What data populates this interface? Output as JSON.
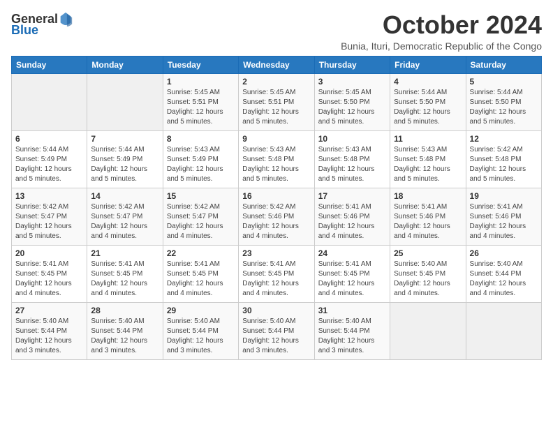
{
  "logo": {
    "general": "General",
    "blue": "Blue"
  },
  "title": "October 2024",
  "location": "Bunia, Ituri, Democratic Republic of the Congo",
  "weekdays": [
    "Sunday",
    "Monday",
    "Tuesday",
    "Wednesday",
    "Thursday",
    "Friday",
    "Saturday"
  ],
  "weeks": [
    [
      {
        "day": "",
        "sunrise": "",
        "sunset": "",
        "daylight": ""
      },
      {
        "day": "",
        "sunrise": "",
        "sunset": "",
        "daylight": ""
      },
      {
        "day": "1",
        "sunrise": "Sunrise: 5:45 AM",
        "sunset": "Sunset: 5:51 PM",
        "daylight": "Daylight: 12 hours and 5 minutes."
      },
      {
        "day": "2",
        "sunrise": "Sunrise: 5:45 AM",
        "sunset": "Sunset: 5:51 PM",
        "daylight": "Daylight: 12 hours and 5 minutes."
      },
      {
        "day": "3",
        "sunrise": "Sunrise: 5:45 AM",
        "sunset": "Sunset: 5:50 PM",
        "daylight": "Daylight: 12 hours and 5 minutes."
      },
      {
        "day": "4",
        "sunrise": "Sunrise: 5:44 AM",
        "sunset": "Sunset: 5:50 PM",
        "daylight": "Daylight: 12 hours and 5 minutes."
      },
      {
        "day": "5",
        "sunrise": "Sunrise: 5:44 AM",
        "sunset": "Sunset: 5:50 PM",
        "daylight": "Daylight: 12 hours and 5 minutes."
      }
    ],
    [
      {
        "day": "6",
        "sunrise": "Sunrise: 5:44 AM",
        "sunset": "Sunset: 5:49 PM",
        "daylight": "Daylight: 12 hours and 5 minutes."
      },
      {
        "day": "7",
        "sunrise": "Sunrise: 5:44 AM",
        "sunset": "Sunset: 5:49 PM",
        "daylight": "Daylight: 12 hours and 5 minutes."
      },
      {
        "day": "8",
        "sunrise": "Sunrise: 5:43 AM",
        "sunset": "Sunset: 5:49 PM",
        "daylight": "Daylight: 12 hours and 5 minutes."
      },
      {
        "day": "9",
        "sunrise": "Sunrise: 5:43 AM",
        "sunset": "Sunset: 5:48 PM",
        "daylight": "Daylight: 12 hours and 5 minutes."
      },
      {
        "day": "10",
        "sunrise": "Sunrise: 5:43 AM",
        "sunset": "Sunset: 5:48 PM",
        "daylight": "Daylight: 12 hours and 5 minutes."
      },
      {
        "day": "11",
        "sunrise": "Sunrise: 5:43 AM",
        "sunset": "Sunset: 5:48 PM",
        "daylight": "Daylight: 12 hours and 5 minutes."
      },
      {
        "day": "12",
        "sunrise": "Sunrise: 5:42 AM",
        "sunset": "Sunset: 5:48 PM",
        "daylight": "Daylight: 12 hours and 5 minutes."
      }
    ],
    [
      {
        "day": "13",
        "sunrise": "Sunrise: 5:42 AM",
        "sunset": "Sunset: 5:47 PM",
        "daylight": "Daylight: 12 hours and 5 minutes."
      },
      {
        "day": "14",
        "sunrise": "Sunrise: 5:42 AM",
        "sunset": "Sunset: 5:47 PM",
        "daylight": "Daylight: 12 hours and 4 minutes."
      },
      {
        "day": "15",
        "sunrise": "Sunrise: 5:42 AM",
        "sunset": "Sunset: 5:47 PM",
        "daylight": "Daylight: 12 hours and 4 minutes."
      },
      {
        "day": "16",
        "sunrise": "Sunrise: 5:42 AM",
        "sunset": "Sunset: 5:46 PM",
        "daylight": "Daylight: 12 hours and 4 minutes."
      },
      {
        "day": "17",
        "sunrise": "Sunrise: 5:41 AM",
        "sunset": "Sunset: 5:46 PM",
        "daylight": "Daylight: 12 hours and 4 minutes."
      },
      {
        "day": "18",
        "sunrise": "Sunrise: 5:41 AM",
        "sunset": "Sunset: 5:46 PM",
        "daylight": "Daylight: 12 hours and 4 minutes."
      },
      {
        "day": "19",
        "sunrise": "Sunrise: 5:41 AM",
        "sunset": "Sunset: 5:46 PM",
        "daylight": "Daylight: 12 hours and 4 minutes."
      }
    ],
    [
      {
        "day": "20",
        "sunrise": "Sunrise: 5:41 AM",
        "sunset": "Sunset: 5:45 PM",
        "daylight": "Daylight: 12 hours and 4 minutes."
      },
      {
        "day": "21",
        "sunrise": "Sunrise: 5:41 AM",
        "sunset": "Sunset: 5:45 PM",
        "daylight": "Daylight: 12 hours and 4 minutes."
      },
      {
        "day": "22",
        "sunrise": "Sunrise: 5:41 AM",
        "sunset": "Sunset: 5:45 PM",
        "daylight": "Daylight: 12 hours and 4 minutes."
      },
      {
        "day": "23",
        "sunrise": "Sunrise: 5:41 AM",
        "sunset": "Sunset: 5:45 PM",
        "daylight": "Daylight: 12 hours and 4 minutes."
      },
      {
        "day": "24",
        "sunrise": "Sunrise: 5:41 AM",
        "sunset": "Sunset: 5:45 PM",
        "daylight": "Daylight: 12 hours and 4 minutes."
      },
      {
        "day": "25",
        "sunrise": "Sunrise: 5:40 AM",
        "sunset": "Sunset: 5:45 PM",
        "daylight": "Daylight: 12 hours and 4 minutes."
      },
      {
        "day": "26",
        "sunrise": "Sunrise: 5:40 AM",
        "sunset": "Sunset: 5:44 PM",
        "daylight": "Daylight: 12 hours and 4 minutes."
      }
    ],
    [
      {
        "day": "27",
        "sunrise": "Sunrise: 5:40 AM",
        "sunset": "Sunset: 5:44 PM",
        "daylight": "Daylight: 12 hours and 3 minutes."
      },
      {
        "day": "28",
        "sunrise": "Sunrise: 5:40 AM",
        "sunset": "Sunset: 5:44 PM",
        "daylight": "Daylight: 12 hours and 3 minutes."
      },
      {
        "day": "29",
        "sunrise": "Sunrise: 5:40 AM",
        "sunset": "Sunset: 5:44 PM",
        "daylight": "Daylight: 12 hours and 3 minutes."
      },
      {
        "day": "30",
        "sunrise": "Sunrise: 5:40 AM",
        "sunset": "Sunset: 5:44 PM",
        "daylight": "Daylight: 12 hours and 3 minutes."
      },
      {
        "day": "31",
        "sunrise": "Sunrise: 5:40 AM",
        "sunset": "Sunset: 5:44 PM",
        "daylight": "Daylight: 12 hours and 3 minutes."
      },
      {
        "day": "",
        "sunrise": "",
        "sunset": "",
        "daylight": ""
      },
      {
        "day": "",
        "sunrise": "",
        "sunset": "",
        "daylight": ""
      }
    ]
  ]
}
